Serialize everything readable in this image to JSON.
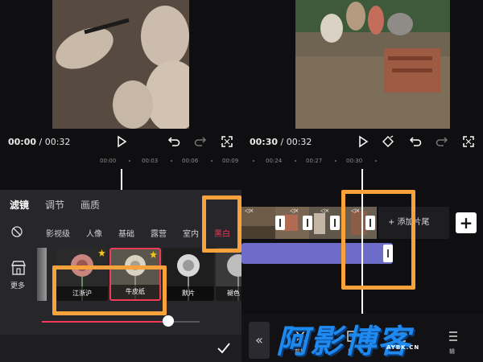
{
  "left": {
    "time_current": "00:00",
    "time_total": "00:32",
    "ruler_ticks": [
      "00:00",
      "00:03",
      "00:06",
      "00:09"
    ],
    "tabs": [
      "滤镜",
      "调节",
      "画质"
    ],
    "categories": [
      "影视级",
      "人像",
      "基础",
      "露营",
      "室内",
      "黑白"
    ],
    "more_label": "更多",
    "filters": [
      {
        "name": "江浙沪",
        "selected": false
      },
      {
        "name": "牛皮纸",
        "selected": true
      },
      {
        "name": "默片",
        "selected": false
      },
      {
        "name": "褪色",
        "selected": false
      }
    ],
    "intensity": 0.8
  },
  "right": {
    "time_current": "00:30",
    "time_total": "00:32",
    "ruler_ticks": [
      "00:24",
      "00:27",
      "00:30"
    ],
    "add_tail_label": "+ 添加片尾",
    "add_clip_label": "+",
    "tool_labels": [
      "剪辑",
      "剪",
      "辑"
    ]
  },
  "watermark": {
    "brand": "阿影博客",
    "domain": "AYBK.CN"
  },
  "colors": {
    "accent_red": "#ef3b55",
    "highlight_orange": "#f7a23b",
    "track_purple": "#6d6cc8",
    "watermark_blue": "#1e8af0"
  }
}
